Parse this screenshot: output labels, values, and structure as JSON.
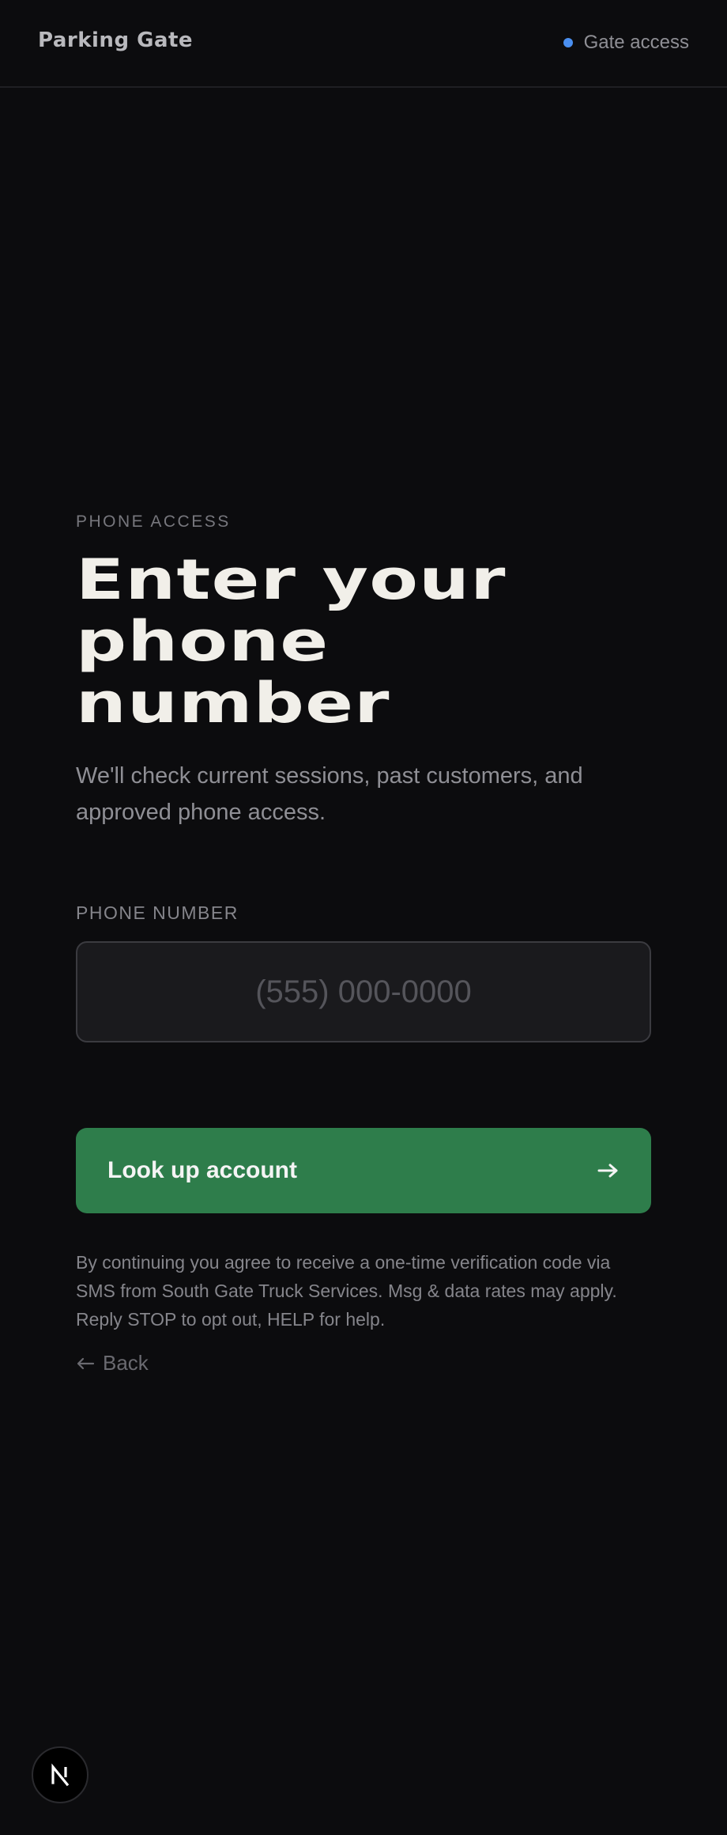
{
  "header": {
    "brand": "Parking Gate",
    "status_label": "Gate access",
    "status_color": "#4a8ff0"
  },
  "main": {
    "eyebrow": "PHONE ACCESS",
    "heading": "Enter your phone number",
    "subtitle": "We'll check current sessions, past customers, and approved phone access.",
    "phone_field": {
      "label": "PHONE NUMBER",
      "value": "",
      "placeholder": "(555) 000-0000"
    },
    "submit": {
      "label": "Look up account",
      "icon": "arrow-right-icon",
      "color": "#2e7d4b"
    },
    "disclaimer": "By continuing you agree to receive a one-time verification code via SMS from South Gate Truck Services. Msg & data rates may apply. Reply STOP to opt out, HELP for help.",
    "back": {
      "label": "Back",
      "icon": "arrow-left-icon"
    }
  },
  "dev_badge": {
    "icon": "nextjs-logo-icon"
  }
}
